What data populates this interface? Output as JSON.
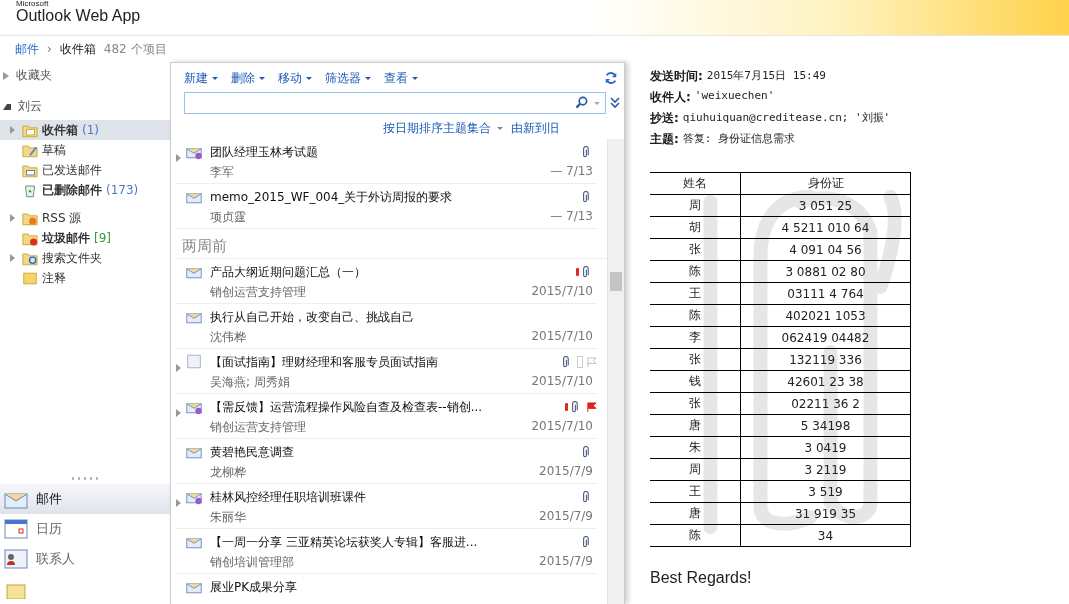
{
  "app": {
    "title": "Outlook Web App",
    "vendor": "Microsoft"
  },
  "breadcrumb": {
    "parent": "邮件",
    "separator": "›",
    "current": "收件箱",
    "count": "482 个项目"
  },
  "sidebar": {
    "favorites": {
      "label": "收藏夹",
      "expanded": false
    },
    "mailbox": {
      "label": "刘云",
      "expanded": true,
      "folders": [
        {
          "label": "收件箱",
          "count": "(1)",
          "bold": true,
          "selected": true,
          "expander": true
        },
        {
          "label": "草稿",
          "bold": false,
          "selected": false,
          "expander": false
        },
        {
          "label": "已发送邮件",
          "bold": false,
          "selected": false,
          "expander": false
        },
        {
          "label": "已删除邮件",
          "count": "(173)",
          "bold": true,
          "selected": false,
          "expander": false
        },
        {
          "label": "RSS 源",
          "bold": false,
          "selected": false,
          "expander": true
        },
        {
          "label": "垃圾邮件",
          "count": "[9]",
          "bold": true,
          "selected": false,
          "expander": false
        },
        {
          "label": "搜索文件夹",
          "bold": false,
          "selected": false,
          "expander": true
        },
        {
          "label": "注释",
          "bold": false,
          "selected": false,
          "expander": false
        }
      ]
    },
    "nav": [
      {
        "label": "邮件",
        "selected": true
      },
      {
        "label": "日历",
        "selected": false
      },
      {
        "label": "联系人",
        "selected": false
      },
      {
        "selected": false
      }
    ]
  },
  "toolbar": [
    "新建",
    "删除",
    "移动",
    "筛选器",
    "查看"
  ],
  "sort": {
    "arrange": "按日期排序主题集合",
    "order": "由新到旧"
  },
  "messages": [
    {
      "kind": "message",
      "subject": "团队经理玉林考试题",
      "sender": "李军",
      "date": "— 7/13",
      "expander": true,
      "important": false,
      "attachment": true,
      "flagged": false
    },
    {
      "kind": "message",
      "subject": "memo_2015_WF_004_关于外访周报的要求",
      "sender": "项贞霆",
      "date": "— 7/13",
      "expander": false,
      "important": false,
      "attachment": true,
      "flagged": false
    },
    {
      "kind": "group",
      "label": "两周前"
    },
    {
      "kind": "message",
      "subject": "产品大纲近期问题汇总（一）",
      "sender": "销创运营支持管理",
      "date": "2015/7/10",
      "expander": false,
      "important": true,
      "attachment": true,
      "flagged": false
    },
    {
      "kind": "message",
      "subject": "执行从自己开始，改变自己、挑战自己",
      "sender": "沈伟桦",
      "date": "2015/7/10",
      "expander": false,
      "important": false,
      "attachment": false,
      "flagged": false
    },
    {
      "kind": "message",
      "subject": "【面试指南】理财经理和客服专员面试指南",
      "sender": "吴海燕; 周秀娟",
      "date": "2015/7/10",
      "expander": true,
      "important": false,
      "attachment": true,
      "flagged": false
    },
    {
      "kind": "message",
      "subject": "【需反馈】运营流程操作风险自查及检查表--销创...",
      "sender": "销创运营支持管理",
      "date": "2015/7/10",
      "expander": true,
      "important": true,
      "attachment": true,
      "flagged": true
    },
    {
      "kind": "message",
      "subject": "黄碧艳民意调查",
      "sender": "龙柳桦",
      "date": "2015/7/9",
      "expander": false,
      "important": false,
      "attachment": true,
      "flagged": false
    },
    {
      "kind": "message",
      "subject": "桂林风控经理任职培训班课件",
      "sender": "朱丽华",
      "date": "2015/7/9",
      "expander": true,
      "important": false,
      "attachment": true,
      "flagged": false
    },
    {
      "kind": "message",
      "subject": "【一周一分享 三亚精英论坛获奖人专辑】客服进...",
      "sender": "销创培训管理部",
      "date": "2015/7/9",
      "expander": false,
      "important": false,
      "attachment": true,
      "flagged": false
    },
    {
      "kind": "message",
      "subject": "展业PK成果分享",
      "expander": false,
      "important": false,
      "attachment": false,
      "flagged": false
    }
  ],
  "reading": {
    "headers": [
      {
        "label": "发送时间:",
        "value": "2015年7月15日 15:49"
      },
      {
        "label": "收件人:",
        "value": "'weixuechen'"
      },
      {
        "label": "抄送:",
        "value": "qiuhuiquan@creditease.cn; '刘振'"
      },
      {
        "label": "主题:",
        "value": "答复: 身份证信息需求"
      }
    ],
    "table": {
      "columns": [
        "姓名",
        "身份证"
      ],
      "rows": [
        [
          "周",
          "3 051 25"
        ],
        [
          "胡",
          "4 5211 010 64"
        ],
        [
          "张",
          "4 091 04 56"
        ],
        [
          "陈",
          "3 0881 02 80"
        ],
        [
          "王",
          "03111 4 764"
        ],
        [
          "陈",
          "402021 1053"
        ],
        [
          "李",
          "062419 04482"
        ],
        [
          "张",
          "132119 336"
        ],
        [
          "钱",
          "42601 23 38"
        ],
        [
          "张",
          "02211 36 2"
        ],
        [
          "唐",
          "5 34198"
        ],
        [
          "朱",
          "3 0419"
        ],
        [
          "周",
          "3 2119"
        ],
        [
          "王",
          "3 519"
        ],
        [
          "唐",
          "31 919 35"
        ],
        [
          "陈",
          "34"
        ]
      ]
    },
    "closing": "Best Regards!"
  }
}
